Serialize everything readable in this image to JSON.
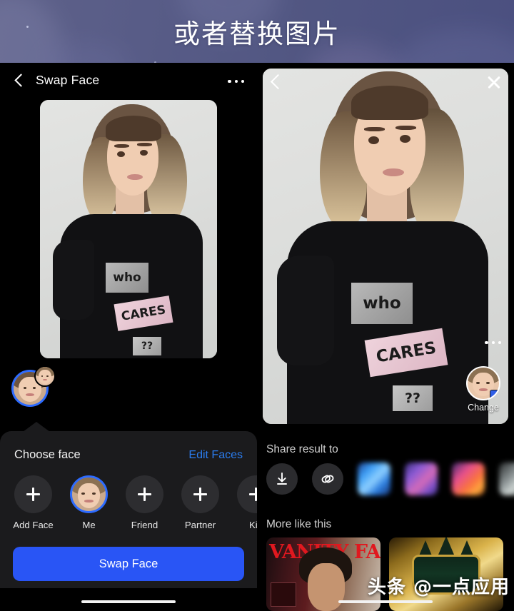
{
  "banner": {
    "title": "或者替换图片",
    "bg_color_left": "#5e6189",
    "bg_color_right": "#4b5080"
  },
  "left_panel": {
    "header": {
      "back_icon": "chevron-left-icon",
      "title": "Swap Face",
      "menu_icon": "kebab-menu-icon"
    },
    "source_photo": {
      "alt": "woman with blonde bob haircut in black t-shirt",
      "shirt_patch_1": "who",
      "shirt_patch_2": "CARES",
      "shirt_patch_3": "??"
    },
    "sheet": {
      "title": "Choose face",
      "edit_link": "Edit Faces",
      "faces": [
        {
          "label": "Add Face",
          "type": "add",
          "selected": false
        },
        {
          "label": "Me",
          "type": "avatar",
          "selected": true
        },
        {
          "label": "Friend",
          "type": "add",
          "selected": false
        },
        {
          "label": "Partner",
          "type": "add",
          "selected": false
        },
        {
          "label": "Kid",
          "type": "add",
          "selected": false
        }
      ],
      "primary_button": "Swap Face",
      "primary_button_color": "#2955f5"
    }
  },
  "right_panel": {
    "back_icon": "chevron-left-icon",
    "close_icon": "close-x-icon",
    "result_menu_icon": "kebab-menu-icon",
    "change_label": "Change",
    "result_photo": {
      "alt": "face-swapped result, girl face on woman body in black t-shirt",
      "shirt_patch_1": "who",
      "shirt_patch_2": "CARES",
      "shirt_patch_3": "??"
    },
    "share": {
      "title": "Share result to",
      "save_icon": "download-icon",
      "link_icon": "link-chain-icon",
      "apps": [
        {
          "name": "share-app-blue",
          "color": "#3d9ef5"
        },
        {
          "name": "share-app-purple",
          "color": "#8a5ad6"
        },
        {
          "name": "share-app-instagram",
          "color": "#e8508e"
        },
        {
          "name": "share-app-grey",
          "color": "#8d9596"
        }
      ]
    },
    "more": {
      "title": "More like this",
      "items": [
        {
          "name": "thumbnail-vanity-fair",
          "caption": "VANITY FAIR"
        },
        {
          "name": "thumbnail-crown",
          "caption": ""
        }
      ]
    },
    "watermark": "头条 @一点应用"
  }
}
